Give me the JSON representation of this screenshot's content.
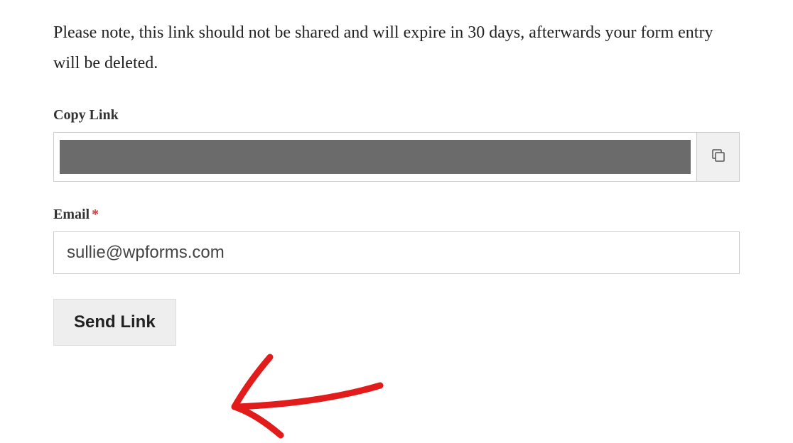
{
  "note": "Please note, this link should not be shared and will expire in 30 days, afterwards your form entry will be deleted.",
  "copyLink": {
    "label": "Copy Link",
    "value": ""
  },
  "email": {
    "label": "Email",
    "required": true,
    "value": "sullie@wpforms.com"
  },
  "submit": {
    "label": "Send Link"
  }
}
